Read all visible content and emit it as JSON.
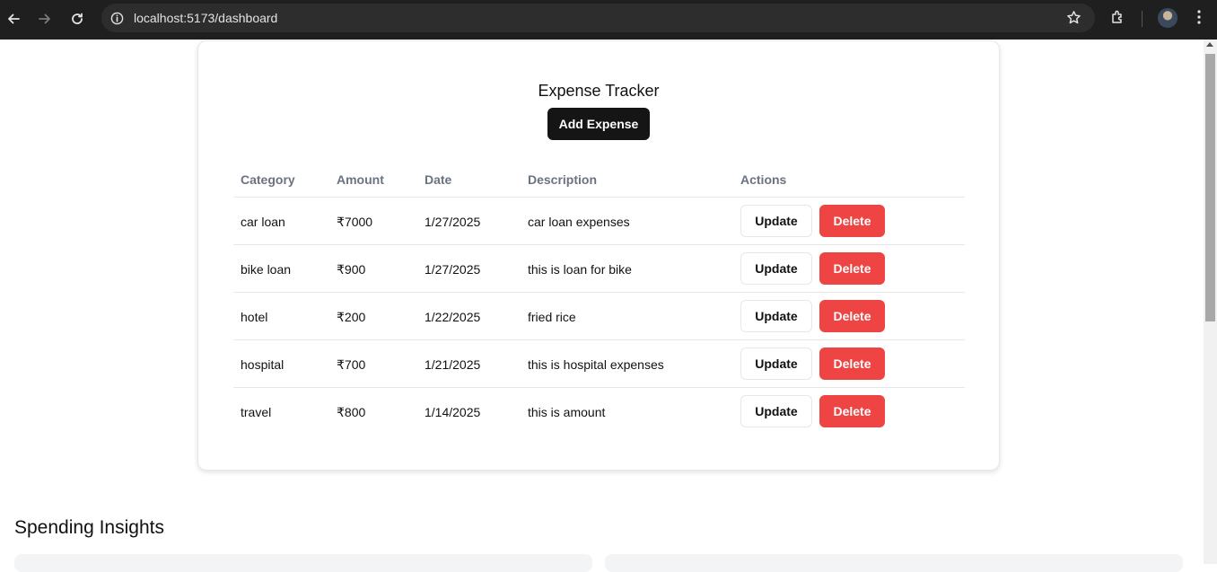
{
  "browser": {
    "url": "localhost:5173/dashboard"
  },
  "card": {
    "title": "Expense Tracker",
    "add_label": "Add Expense"
  },
  "table": {
    "headers": [
      "Category",
      "Amount",
      "Date",
      "Description",
      "Actions"
    ],
    "rows": [
      {
        "category": "car loan",
        "amount": "₹7000",
        "date": "1/27/2025",
        "description": "car loan expenses"
      },
      {
        "category": "bike loan",
        "amount": "₹900",
        "date": "1/27/2025",
        "description": "this is loan for bike"
      },
      {
        "category": "hotel",
        "amount": "₹200",
        "date": "1/22/2025",
        "description": "fried rice"
      },
      {
        "category": "hospital",
        "amount": "₹700",
        "date": "1/21/2025",
        "description": "this is hospital expenses"
      },
      {
        "category": "travel",
        "amount": "₹800",
        "date": "1/14/2025",
        "description": "this is amount"
      }
    ],
    "update_label": "Update",
    "delete_label": "Delete"
  },
  "insights": {
    "title": "Spending Insights"
  },
  "colors": {
    "primary_button": "#151515",
    "delete_button": "#ef4444",
    "header_text": "#6b7280"
  }
}
